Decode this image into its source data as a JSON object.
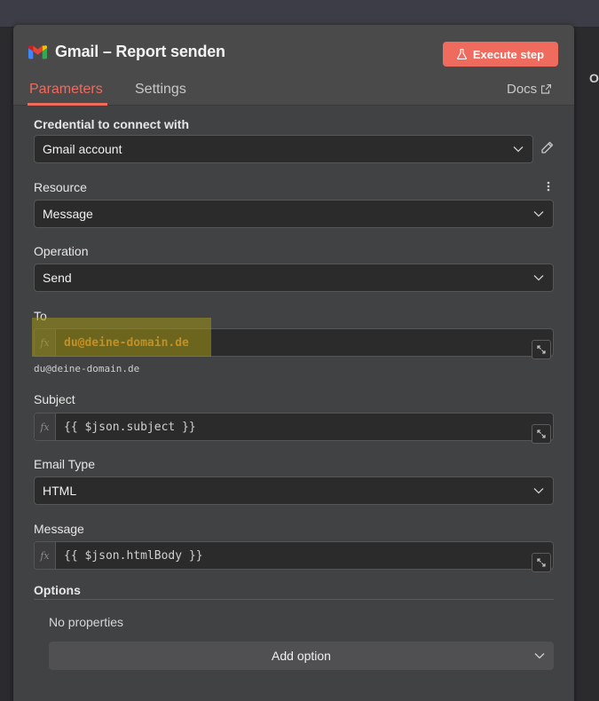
{
  "header": {
    "title": "Gmail – Report senden",
    "execute_label": "Execute step",
    "tabs": [
      {
        "label": "Parameters",
        "active": true
      },
      {
        "label": "Settings",
        "active": false
      }
    ],
    "docs_label": "Docs",
    "accent_color": "#ee6b5e"
  },
  "side": {
    "right_letter": "O"
  },
  "fields": {
    "credential": {
      "label": "Credential to connect with",
      "value": "Gmail account"
    },
    "resource": {
      "label": "Resource",
      "value": "Message"
    },
    "operation": {
      "label": "Operation",
      "value": "Send"
    },
    "to": {
      "label": "To",
      "fx": "fx",
      "value": "du@deine-domain.de",
      "resolved": "du@deine-domain.de"
    },
    "subject": {
      "label": "Subject",
      "fx": "fx",
      "value": "{{ $json.subject }}"
    },
    "email_type": {
      "label": "Email Type",
      "value": "HTML"
    },
    "message": {
      "label": "Message",
      "fx": "fx",
      "value": "{{ $json.htmlBody }}"
    }
  },
  "options": {
    "label": "Options",
    "empty_text": "No properties",
    "add_label": "Add option"
  }
}
